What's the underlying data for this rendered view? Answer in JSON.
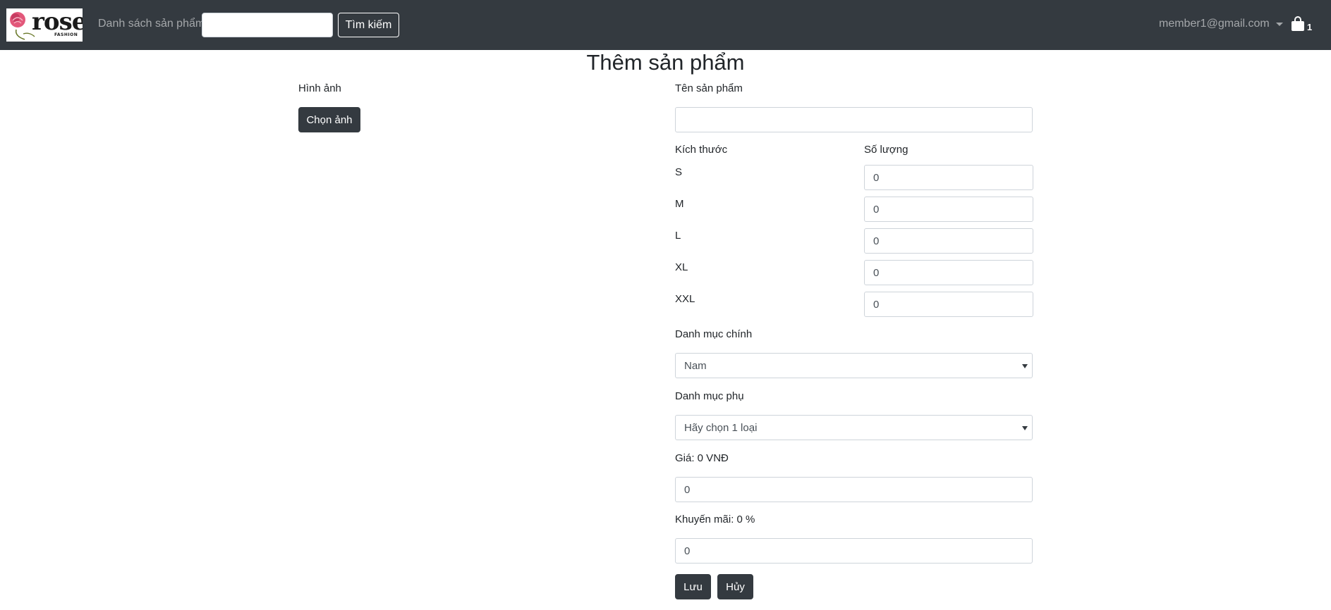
{
  "navbar": {
    "logo_text": "rose",
    "logo_sub": "FASHION",
    "product_list_link": "Danh sách sản phẩm",
    "search_value": "",
    "search_button": "Tìm kiếm",
    "user_email": "member1@gmail.com",
    "cart_count": "1"
  },
  "page_title": "Thêm sản phẩm",
  "image_section": {
    "label": "Hình ảnh",
    "choose_button": "Chọn ảnh"
  },
  "form": {
    "name_label": "Tên sản phẩm",
    "name_value": "",
    "size_header": "Kích thước",
    "qty_header": "Số lượng",
    "sizes": [
      {
        "size": "S",
        "qty": "0"
      },
      {
        "size": "M",
        "qty": "0"
      },
      {
        "size": "L",
        "qty": "0"
      },
      {
        "size": "XL",
        "qty": "0"
      },
      {
        "size": "XXL",
        "qty": "0"
      }
    ],
    "main_category_label": "Danh mục chính",
    "main_category_value": "Nam",
    "sub_category_label": "Danh mục phụ",
    "sub_category_value": "Hãy chọn 1 loại",
    "price_label": "Giá: 0 VNĐ",
    "price_value": "0",
    "discount_label": "Khuyến mãi: 0 %",
    "discount_value": "0",
    "save_button": "Lưu",
    "cancel_button": "Hủy"
  },
  "colors": {
    "navbar_bg": "#343a40",
    "button_dark": "#343a40",
    "input_border": "#ced4da"
  }
}
